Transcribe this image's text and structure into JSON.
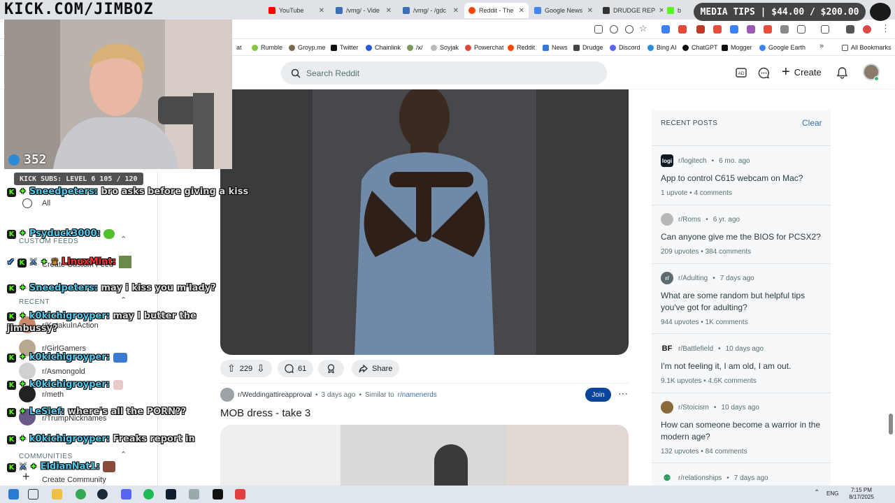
{
  "browser": {
    "tabs": [
      {
        "label": "",
        "color": "#e2e2e2"
      },
      {
        "label": "YouTube",
        "color": "#ff0000"
      },
      {
        "label": "/vmg/ - Vide",
        "color": "#3b6fb6"
      },
      {
        "label": "/vmg/ - /gdc",
        "color": "#3b6fb6"
      },
      {
        "label": "Reddit - The",
        "color": "#ff4500"
      },
      {
        "label": "Google News",
        "color": "#4285f4"
      },
      {
        "label": "DRUDGE REP",
        "color": "#333333"
      },
      {
        "label": "b",
        "color": "#53fc18"
      }
    ],
    "bookmarks": [
      {
        "label": "at",
        "color": "#666666"
      },
      {
        "label": "Rumble",
        "color": "#85c742"
      },
      {
        "label": "Groyp.me",
        "color": "#7a6a4a"
      },
      {
        "label": "Twitter",
        "color": "#111111"
      },
      {
        "label": "Chainlink",
        "color": "#2a5ada"
      },
      {
        "label": "/x/",
        "color": "#7a9a5a"
      },
      {
        "label": "Soyjak",
        "color": "#bbbbbb"
      },
      {
        "label": "Powerchat",
        "color": "#e0483a"
      },
      {
        "label": "Reddit",
        "color": "#ff4500"
      },
      {
        "label": "News",
        "color": "#3a78d6"
      },
      {
        "label": "Drudge",
        "color": "#444444"
      },
      {
        "label": "Discord",
        "color": "#5865f2"
      },
      {
        "label": "Bing AI",
        "color": "#2e8bd8"
      },
      {
        "label": "ChatGPT",
        "color": "#111111"
      },
      {
        "label": "Mogger",
        "color": "#111111"
      },
      {
        "label": "Google Earth",
        "color": "#3b82f6"
      }
    ],
    "all_bookmarks": "All Bookmarks"
  },
  "reddit": {
    "search_placeholder": "Search Reddit",
    "create_label": "Create",
    "post1": {
      "votes": "229",
      "comments": "61",
      "share_label": "Share"
    },
    "post2": {
      "subreddit": "r/Weddingattireapproval",
      "age": "3 days ago",
      "similar_prefix": "Similar to",
      "similar_sub": "r/namenerds",
      "join_label": "Join",
      "title": "MOB dress - take 3"
    },
    "recent_posts": {
      "heading": "RECENT POSTS",
      "clear_label": "Clear",
      "items": [
        {
          "sub": "r/logitech",
          "age": "6 mo. ago",
          "title": "App to control C615 webcam on Mac?",
          "upvotes": "1 upvote",
          "comments": "4 comments",
          "avatar": "logi",
          "avatar_color": "#0f1a22"
        },
        {
          "sub": "r/Roms",
          "age": "6 yr. ago",
          "title": "Can anyone give me the BIOS for PCSX2?",
          "upvotes": "209 upvotes",
          "comments": "384 comments",
          "avatar": "",
          "avatar_color": "#b8b8b8"
        },
        {
          "sub": "r/Adulting",
          "age": "7 days ago",
          "title": "What are some random but helpful tips you've got for adulting?",
          "upvotes": "944 upvotes",
          "comments": "1K comments",
          "avatar": "r/",
          "avatar_color": "#5c6b70"
        },
        {
          "sub": "r/Battlefield",
          "age": "10 days ago",
          "title": "I'm not feeling it, I am old, I am out.",
          "upvotes": "9.1K upvotes",
          "comments": "4.6K comments",
          "avatar": "BF",
          "avatar_color": "#111111"
        },
        {
          "sub": "r/Stoicism",
          "age": "10 days ago",
          "title": "How can someone become a warrior in the modern age?",
          "upvotes": "132 upvotes",
          "comments": "84 comments",
          "avatar": "",
          "avatar_color": "#8a6a3a"
        },
        {
          "sub": "r/relationships",
          "age": "7 days ago",
          "title": "",
          "upvotes": "",
          "comments": "",
          "avatar": "",
          "avatar_color": "#2e9a5a"
        }
      ]
    },
    "left_nav": {
      "all": "All",
      "custom_feeds_heading": "CUSTOM FEEDS",
      "create_custom_feed": "Create Custom Feed",
      "recent_heading": "RECENT",
      "recent": [
        "r/KotakuInAction",
        "r/GirlGamers",
        "r/Asmongold",
        "r/meth",
        "r/TrumpNicknames"
      ],
      "communities_heading": "COMMUNITIES",
      "create_community": "Create Community"
    }
  },
  "stream_overlay": {
    "brand": "KICK.COM/JIMBOZ",
    "tips": "MEDIA TIPS | $44.00 / $200.00",
    "viewers": "352",
    "subs_goal": "KICK SUBS: LEVEL 6 105 / 120",
    "chat": [
      {
        "user": "Sneedpeters:",
        "msg": "bro asks before giving a kiss"
      },
      {
        "user": "Psyduck3000:",
        "msg": ""
      },
      {
        "user": "LinuxMint:",
        "msg": ""
      },
      {
        "user": "Sneedpeters:",
        "msg": "may i kiss you m'lady?"
      },
      {
        "user": "k0kichigroyper:",
        "msg": "may I butter the jimbussy?"
      },
      {
        "user": "k0kichigroyper:",
        "msg": ""
      },
      {
        "user": "k0kichigroyper:",
        "msg": ""
      },
      {
        "user": "LeSief:",
        "msg": "where's all the PORN??"
      },
      {
        "user": "k0kichigroyper:",
        "msg": "Freaks report in"
      },
      {
        "user": "EldianNat1:",
        "msg": ""
      }
    ]
  },
  "taskbar": {
    "lang": "ENG",
    "time": "7:15 PM",
    "date": "8/17/2025"
  }
}
